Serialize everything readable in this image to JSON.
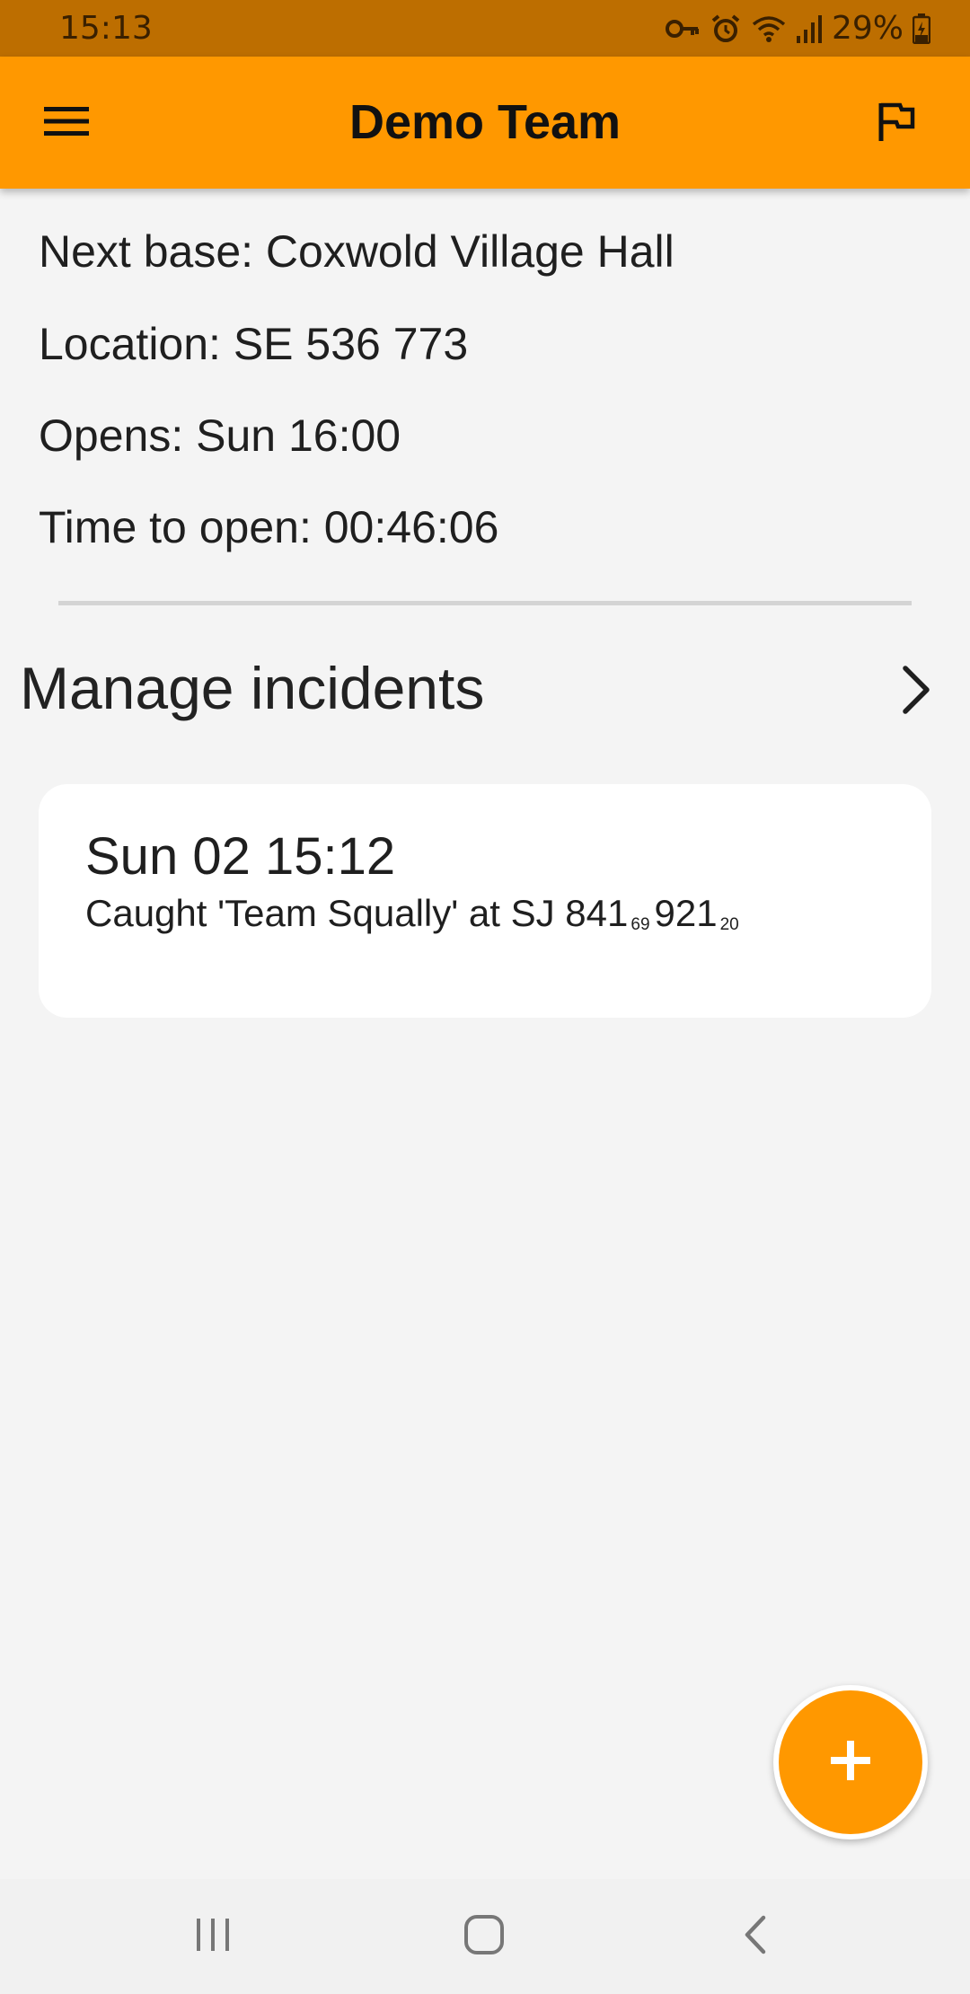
{
  "status_bar": {
    "time": "15:13",
    "battery": "29%",
    "icons": [
      "vpn-key-icon",
      "alarm-icon",
      "wifi-icon",
      "signal-icon",
      "battery-charging-icon"
    ]
  },
  "app_bar": {
    "title": "Demo Team",
    "left_icon": "menu-icon",
    "right_icon": "flag-icon",
    "background_color": "#ff9800"
  },
  "base_info": {
    "next_base": "Next base: Coxwold Village Hall",
    "location": "Location: SE 536 773",
    "opens": "Opens: Sun 16:00",
    "time_to_open": "Time to open: 00:46:06"
  },
  "incidents": {
    "heading": "Manage incidents",
    "items": [
      {
        "time": "Sun 02 15:12",
        "desc_prefix": "Caught 'Team Squally' at SJ 841",
        "easting_sub": "69",
        "northing": "921",
        "northing_sub": "20"
      }
    ]
  },
  "fab": {
    "icon": "plus-icon",
    "color": "#ff9800"
  },
  "nav_bar": {
    "icons": [
      "recent-apps-icon",
      "home-icon",
      "back-icon"
    ]
  }
}
